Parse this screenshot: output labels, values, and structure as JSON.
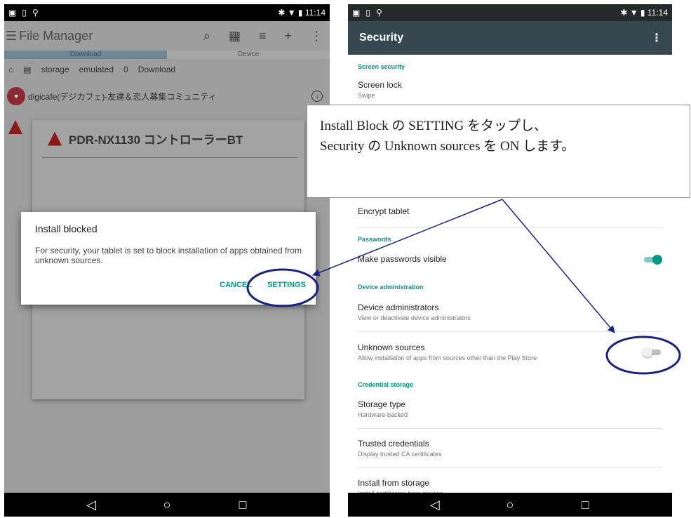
{
  "status_bar": {
    "left_icons": [
      "image-icon",
      "sim-icon",
      "location-icon"
    ],
    "right_text": "✱ ▼ ▮ 11:14",
    "time": "11:14"
  },
  "left_screen": {
    "toolbar": {
      "menu_glyph": "☰",
      "title": "File Manager",
      "actions": [
        "search-icon",
        "grid-icon",
        "sort-icon",
        "add-icon",
        "more-icon"
      ]
    },
    "tabs": [
      "Download",
      "Device"
    ],
    "path": [
      "storage",
      "emulated",
      "0",
      "Download"
    ],
    "rows": [
      {
        "label": "digicafe(デジカフェ)-友達＆恋人募集コミュニティ"
      }
    ],
    "install_card": {
      "title": "PDR-NX1130 コントローラーBT"
    },
    "dialog": {
      "title": "Install blocked",
      "message": "For security, your tablet is set to block installation of apps obtained from unknown sources.",
      "cancel_label": "CANCEL",
      "settings_label": "SETTINGS"
    }
  },
  "right_screen": {
    "appbar": {
      "title": "Security",
      "more_glyph": "⋮"
    },
    "sections": {
      "screen_security": "Screen security",
      "passwords": "Passwords",
      "device_admin": "Device administration",
      "credential_storage": "Credential storage"
    },
    "items": {
      "screen_lock": {
        "title": "Screen lock",
        "subtitle": "Swipe"
      },
      "encrypt": {
        "title": "Encrypt tablet"
      },
      "passwords_visible": {
        "title": "Make passwords visible",
        "enabled": true
      },
      "device_admins": {
        "title": "Device administrators",
        "subtitle": "View or deactivate device administrators"
      },
      "unknown_sources": {
        "title": "Unknown sources",
        "subtitle": "Allow installation of apps from sources other than the Play Store",
        "enabled": false
      },
      "storage_type": {
        "title": "Storage type",
        "subtitle": "Hardware-backed"
      },
      "trusted_credentials": {
        "title": "Trusted credentials",
        "subtitle": "Display trusted CA certificates"
      },
      "install_from_storage": {
        "title": "Install from storage",
        "subtitle": "Install certificates from storage"
      }
    }
  },
  "nav_bar": {
    "back": "◁",
    "home": "○",
    "recents": "□"
  },
  "callout": {
    "line1": "Install Block の SETTING をタップし、",
    "line2": "Security の Unknown sources  を ON します。"
  },
  "colors": {
    "accent": "#009688",
    "appbar": "#37474f",
    "annotation": "#1a237e"
  }
}
